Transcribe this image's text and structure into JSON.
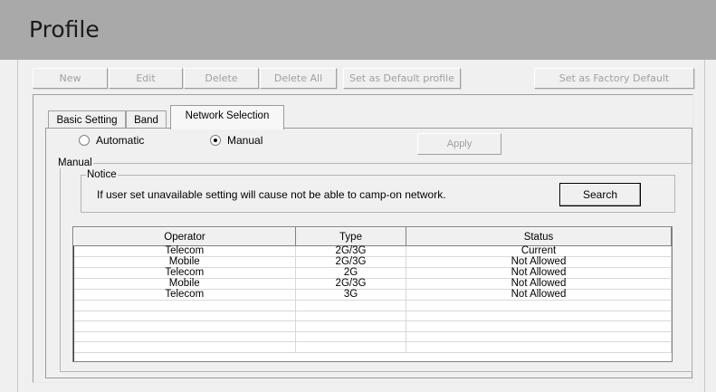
{
  "header": {
    "title": "Profile"
  },
  "toolbar": {
    "new_label": "New",
    "edit_label": "Edit",
    "delete_label": "Delete",
    "delete_all_label": "Delete All",
    "set_default_label": "Set as Default profile",
    "factory_default_label": "Set as Factory Default"
  },
  "tabs": [
    {
      "label": "Basic Setting",
      "active": false
    },
    {
      "label": "Band",
      "active": false
    },
    {
      "label": "Network Selection",
      "active": true
    }
  ],
  "mode": {
    "automatic_label": "Automatic",
    "manual_label": "Manual",
    "selected": "Manual",
    "apply_label": "Apply"
  },
  "manual": {
    "group_label": "Manual",
    "notice_label": "Notice",
    "notice_text": "If user set unavailable setting will cause  not be able to camp-on network.",
    "search_label": "Search"
  },
  "network_table": {
    "columns": [
      "Operator",
      "Type",
      "Status"
    ],
    "rows": [
      [
        "Telecom",
        "2G/3G",
        "Current"
      ],
      [
        "Mobile",
        "2G/3G",
        "Not Allowed"
      ],
      [
        "Telecom",
        "2G",
        "Not Allowed"
      ],
      [
        "Mobile",
        "2G/3G",
        "Not Allowed"
      ],
      [
        "Telecom",
        "3G",
        "Not Allowed"
      ]
    ]
  },
  "colors": {
    "header_bg": "#a9a9a9",
    "window_bg": "#f0f0f0",
    "disabled_text": "#a0a0a0"
  }
}
